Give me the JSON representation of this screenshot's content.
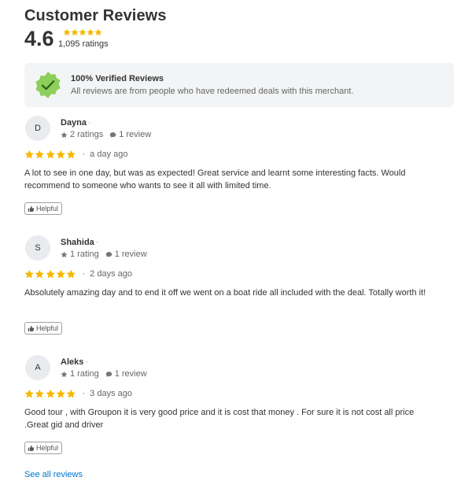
{
  "header": {
    "title": "Customer Reviews",
    "rating": "4.6",
    "ratings_count": "1,095 ratings",
    "star_count": 5
  },
  "verified": {
    "title": "100% Verified Reviews",
    "subtitle": "All reviews are from people who have redeemed deals with this merchant."
  },
  "colors": {
    "star": "#f5b800",
    "check_badge": "#8ccf5a",
    "link": "#0076cc",
    "panel": "#f3f4f5"
  },
  "reviews": [
    {
      "initial": "D",
      "name": "Dayna",
      "ratings": "2 ratings",
      "reviews": "1 review",
      "stars": 5,
      "when": "a day ago",
      "text": "A lot to see in one day, but was as expected! Great service and learnt some interesting facts. Would recommend to someone who wants to see it all with limited time.",
      "helpful": "Helpful"
    },
    {
      "initial": "S",
      "name": "Shahida",
      "ratings": "1 rating",
      "reviews": "1 review",
      "stars": 5,
      "when": "2 days ago",
      "text": "Absolutely amazing day and to end it off we went on a boat ride all included with the deal. Totally worth it!",
      "helpful": "Helpful"
    },
    {
      "initial": "A",
      "name": "Aleks",
      "ratings": "1 rating",
      "reviews": "1 review",
      "stars": 5,
      "when": "3 days ago",
      "text": "Good tour , with Groupon it is very good price and it is cost that money . For sure it is not cost all price .Great gid and driver",
      "helpful": "Helpful"
    }
  ],
  "footer": {
    "see_all": "See all reviews"
  }
}
